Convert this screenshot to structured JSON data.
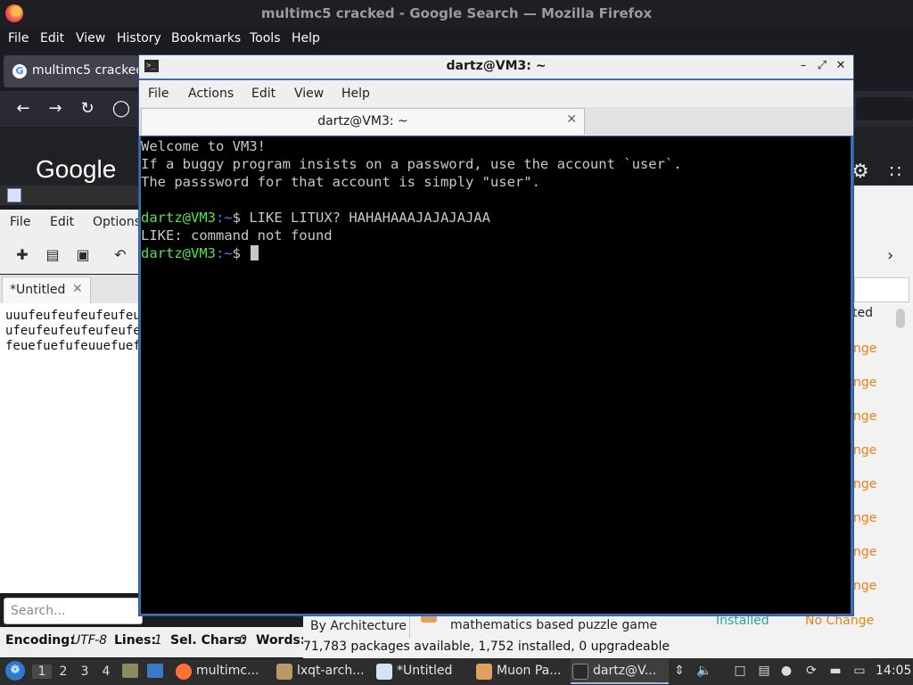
{
  "firefox": {
    "window_title": "multimc5 cracked - Google Search — Mozilla Firefox",
    "menu": [
      "File",
      "Edit",
      "View",
      "History",
      "Bookmarks",
      "Tools",
      "Help"
    ],
    "tab_title": "multimc5 cracked",
    "google_logo": "Google",
    "icons": {
      "back": "back-arrow-icon",
      "forward": "forward-arrow-icon",
      "reload": "reload-icon",
      "shield": "shield-icon",
      "gear": "gear-icon",
      "apps": "apps-grid-icon"
    }
  },
  "featherpad": {
    "menu": [
      "File",
      "Edit",
      "Options"
    ],
    "tab_label": "*Untitled",
    "text_lines": [
      "uuufeufeufeufeufeufe",
      "ufeufeufeufeufeufeu",
      "feuefuefufeuuefuef"
    ],
    "search_placeholder": "Search...",
    "status": {
      "encoding_label": "Encoding:",
      "encoding_value": "UTF-8",
      "lines_label": "Lines:",
      "lines_value": "1",
      "sel_label": "Sel. Chars:",
      "sel_value": "0",
      "words_label": "Words:"
    }
  },
  "muon": {
    "column_header": "ted",
    "nochange_label": "nge",
    "row_count_visible": 8,
    "by_architecture": "By Architecture",
    "last_row_description": "mathematics based puzzle game",
    "last_row_installed": "Installed",
    "last_row_nochange": "No Change",
    "status_line": "71,783 packages available, 1,752 installed, 0 upgradeable"
  },
  "terminal": {
    "window_title": "dartz@VM3: ~",
    "tab_title": "dartz@VM3: ~",
    "menu": [
      "File",
      "Actions",
      "Edit",
      "View",
      "Help"
    ],
    "lines": [
      {
        "text": "Welcome to VM3!"
      },
      {
        "text": "If a buggy program insists on a password, use the account `user`."
      },
      {
        "text": "The passsword for that account is simply \"user\"."
      },
      {
        "text": ""
      },
      {
        "user": "dartz@VM3",
        "path": ":~",
        "cmd": "$ LIKE LITUX? HAHAHAAAJAJAJAJAA"
      },
      {
        "text": "LIKE: command not found"
      },
      {
        "user": "dartz@VM3",
        "path": ":~",
        "cmd": "$ "
      }
    ]
  },
  "taskbar": {
    "desktops": [
      "1",
      "2",
      "3",
      "4"
    ],
    "tasks": [
      {
        "label": "multimc...",
        "icon": "firefox-icon",
        "color": "#ff7139"
      },
      {
        "label": "lxqt-arch...",
        "icon": "package-archive-icon",
        "color": "#b89a6a"
      },
      {
        "label": "*Untitled",
        "icon": "text-editor-icon",
        "color": "#d7e3f4"
      },
      {
        "label": "Muon Pa...",
        "icon": "muon-package-icon",
        "color": "#e0a060"
      },
      {
        "label": "dartz@V...",
        "icon": "terminal-icon",
        "color": "#2a2a2a"
      }
    ],
    "clock": "14:05",
    "colors": {
      "start": "#2e7ad1",
      "panel": "#2d2d2d"
    }
  }
}
